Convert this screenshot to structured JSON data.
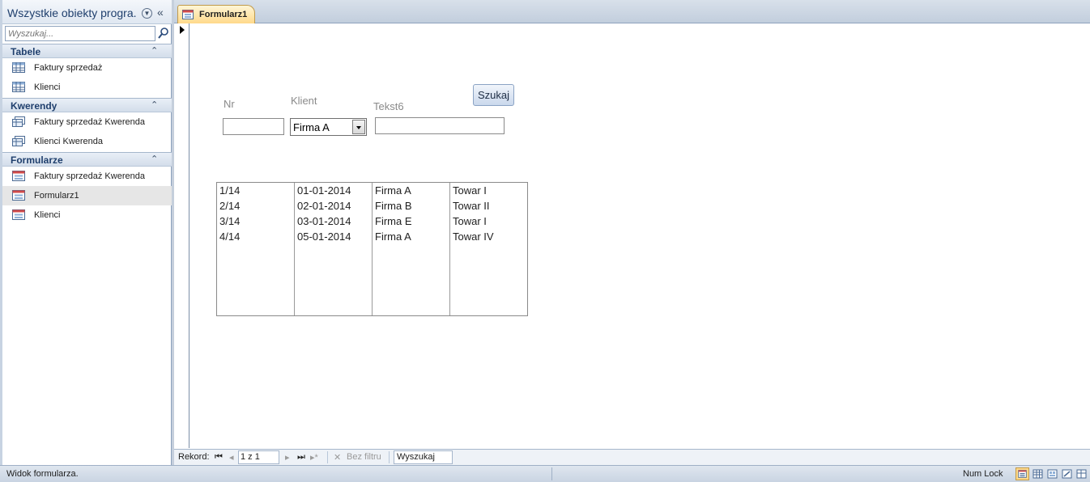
{
  "nav": {
    "title": "Wszystkie obiekty progra...",
    "search_placeholder": "Wyszukaj...",
    "groups": [
      {
        "label": "Tabele",
        "items": [
          {
            "label": "Faktury sprzedaż"
          },
          {
            "label": "Klienci"
          }
        ]
      },
      {
        "label": "Kwerendy",
        "items": [
          {
            "label": "Faktury sprzedaż Kwerenda"
          },
          {
            "label": "Klienci Kwerenda"
          }
        ]
      },
      {
        "label": "Formularze",
        "items": [
          {
            "label": "Faktury sprzedaż Kwerenda"
          },
          {
            "label": "Formularz1",
            "selected": true
          },
          {
            "label": "Klienci"
          }
        ]
      }
    ]
  },
  "tab": {
    "label": "Formularz1"
  },
  "form": {
    "nr_label": "Nr",
    "nr_value": "",
    "klient_label": "Klient",
    "klient_value": "Firma A",
    "tekst6_label": "Tekst6",
    "tekst6_value": "",
    "search_button": "Szukaj",
    "list": {
      "rows": [
        [
          "1/14",
          "01-01-2014",
          "Firma A",
          "Towar I"
        ],
        [
          "2/14",
          "02-01-2014",
          "Firma B",
          "Towar II"
        ],
        [
          "3/14",
          "03-01-2014",
          "Firma E",
          "Towar I"
        ],
        [
          "4/14",
          "05-01-2014",
          "Firma A",
          "Towar IV"
        ]
      ]
    }
  },
  "record_nav": {
    "label": "Rekord:",
    "position": "1 z 1",
    "filter_label": "Bez filtru",
    "search_value": "Wyszukaj"
  },
  "status": {
    "text": "Widok formularza.",
    "numlock": "Num Lock"
  },
  "colors": {
    "accent_tab": "#ffd98a",
    "nav_header_text": "#1f3f6d"
  }
}
